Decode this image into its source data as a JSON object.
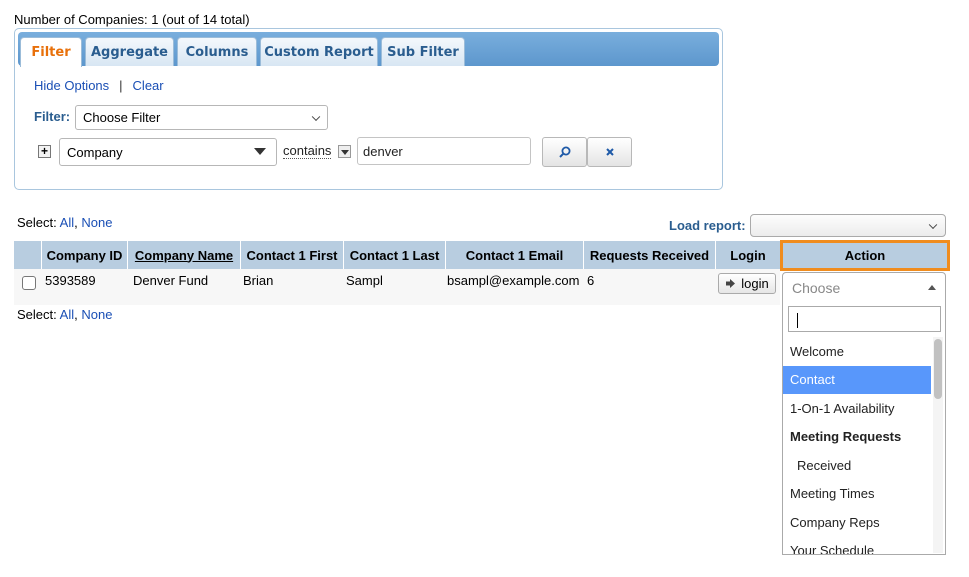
{
  "summary": {
    "count_text": "Number of Companies: 1 (out of 14 total)"
  },
  "tabs": [
    "Filter",
    "Aggregate",
    "Columns",
    "Custom Report",
    "Sub Filter"
  ],
  "options": {
    "hide_options": "Hide Options",
    "separator": "|",
    "clear": "Clear"
  },
  "filter": {
    "label": "Filter:",
    "choose_value": "Choose Filter",
    "field_value": "Company",
    "operator": "contains",
    "value": "denver"
  },
  "select_links": {
    "label": "Select:",
    "all": "All",
    "none": "None"
  },
  "load_report": {
    "label": "Load report:",
    "value": ""
  },
  "table": {
    "headers": [
      "Company ID",
      "Company Name",
      "Contact 1 First",
      "Contact 1 Last",
      "Contact 1 Email",
      "Requests Received",
      "Login"
    ],
    "action_header": "Action",
    "row": {
      "company_id": "5393589",
      "company_name": "Denver Fund",
      "contact_first": "Brian",
      "contact_last": "Sampl",
      "contact_email": "bsampl@example.com",
      "requests_received": "6",
      "login_label": "login"
    }
  },
  "action_dropdown": {
    "placeholder": "Choose",
    "search_value": "",
    "items": [
      {
        "label": "Welcome",
        "kind": "option"
      },
      {
        "label": "Contact",
        "kind": "selected"
      },
      {
        "label": "1-On-1 Availability",
        "kind": "option"
      },
      {
        "label": "Meeting Requests",
        "kind": "group"
      },
      {
        "label": "Received",
        "kind": "child"
      },
      {
        "label": "Meeting Times",
        "kind": "option"
      },
      {
        "label": "Company Reps",
        "kind": "option"
      },
      {
        "label": "Your Schedule",
        "kind": "option"
      }
    ]
  },
  "colors": {
    "accent": "#e8700a",
    "header_bg": "#b8cde0",
    "highlight_border": "#f08c1e",
    "selected_item": "#5897fb"
  }
}
